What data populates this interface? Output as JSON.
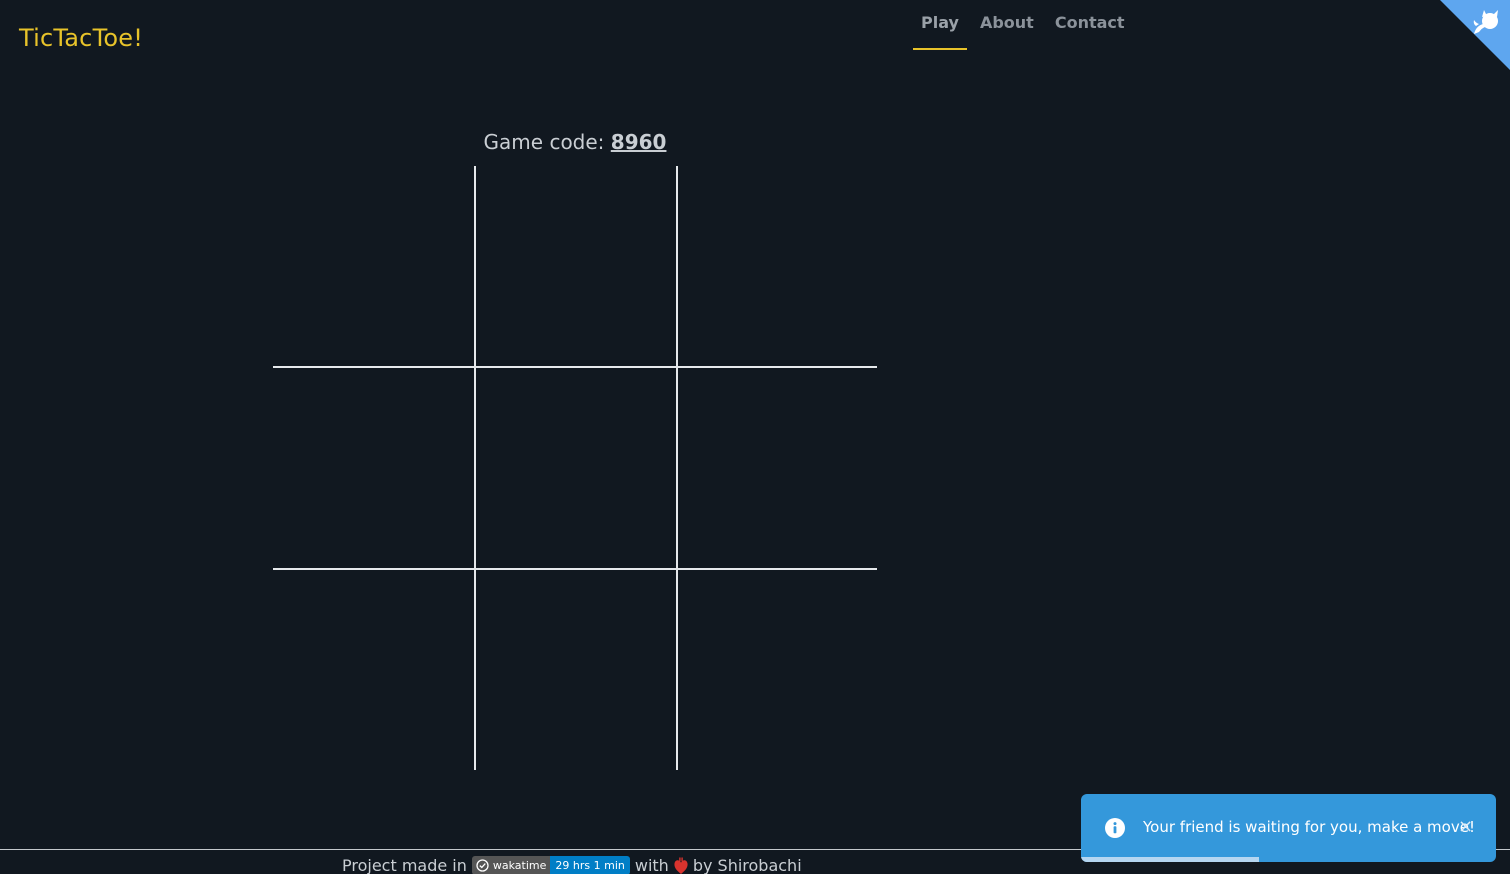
{
  "app": {
    "brand": "TicTacToe!"
  },
  "nav": {
    "items": [
      {
        "label": "Play",
        "active": true
      },
      {
        "label": "About",
        "active": false
      },
      {
        "label": "Contact",
        "active": false
      }
    ]
  },
  "game": {
    "code_label": "Game code:",
    "code": "8960",
    "cells": [
      "",
      "",
      "",
      "",
      "",
      "",
      "",
      "",
      ""
    ]
  },
  "footer": {
    "prefix": "Project made in",
    "badge_label": "wakatime",
    "badge_value": "29 hrs 1 min",
    "with_text": "with",
    "by_text": "by Shirobachi"
  },
  "toast": {
    "message": "Your friend is waiting for you, make a move!",
    "close": "×",
    "progress": 0.43
  },
  "colors": {
    "background": "#111820",
    "brand": "#e8c32a",
    "toast": "#3498db",
    "badge_value": "#007ec6"
  },
  "icons": {
    "corner": "octocat-icon",
    "toast": "info-icon",
    "badge": "wakatime-icon",
    "heart": "heart-icon"
  }
}
